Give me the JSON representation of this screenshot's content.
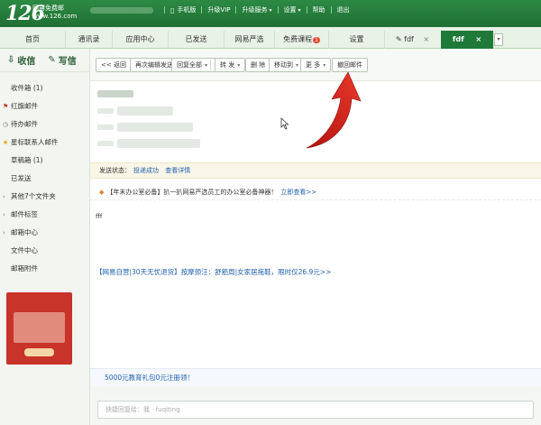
{
  "header": {
    "logo": "126",
    "logo_sub_line1": "网易免费邮",
    "logo_sub_line2": "www.126.com",
    "nav": [
      "手机版",
      "升级VIP",
      "升级服务",
      "设置",
      "帮助",
      "退出"
    ]
  },
  "tabs": [
    {
      "label": "首页",
      "active": false
    },
    {
      "label": "通讯录",
      "active": false
    },
    {
      "label": "应用中心",
      "active": false
    },
    {
      "label": "已发送",
      "active": false
    },
    {
      "label": "网易严选",
      "active": false
    },
    {
      "label": "免费课程",
      "badge": "1",
      "active": false
    },
    {
      "label": "设置",
      "active": false
    },
    {
      "label": "fdf",
      "active": false,
      "closable": true
    },
    {
      "label": "fdf",
      "active": true,
      "closable": true
    }
  ],
  "sidebar": {
    "receive": "收信",
    "write": "写信",
    "folders": [
      {
        "label": "收件箱 (1)",
        "icon": "none"
      },
      {
        "label": "红旗邮件",
        "icon": "flag-icon"
      },
      {
        "label": "待办邮件",
        "icon": "clock-icon"
      },
      {
        "label": "星标联系人邮件",
        "icon": "star-icon"
      },
      {
        "label": "草稿箱 (1)",
        "icon": "none"
      },
      {
        "label": "已发送",
        "icon": "none"
      },
      {
        "label": "其他7个文件夹",
        "icon": "expand-icon"
      },
      {
        "label": "邮件标签",
        "icon": "expand-icon"
      },
      {
        "label": "邮箱中心",
        "icon": "expand-icon"
      },
      {
        "label": "文件中心",
        "icon": "none"
      },
      {
        "label": "邮箱附件",
        "icon": "none"
      }
    ]
  },
  "toolbar": {
    "back": "<< 返回",
    "edit_resend": "再次编辑发送",
    "reply_all": "回复全部",
    "forward": "转 发",
    "delete": "删 除",
    "move_to": "移动到",
    "more": "更 多",
    "recall": "撤回邮件"
  },
  "status": {
    "label": "发送状态：",
    "value": "投递成功",
    "detail": "查看详情"
  },
  "promo": {
    "text": "【年末办公室必备】扒一扒网易严选员工的办公室必备神器！",
    "link": "立即查看>>"
  },
  "mail_body": "fff",
  "ad_line": "【网易自营|30天无忧退货】按摩颈汪：舒筋周|女家居拖鞋，限时仅26.9元>>",
  "bottom_link": "5000元教育礼包0元注册领！",
  "reply_placeholder": "快捷回复给：我 · fuqiting",
  "colors": {
    "brand": "#1f7a3a",
    "link": "#1f5fae",
    "annotation_arrow": "#d3221b"
  }
}
